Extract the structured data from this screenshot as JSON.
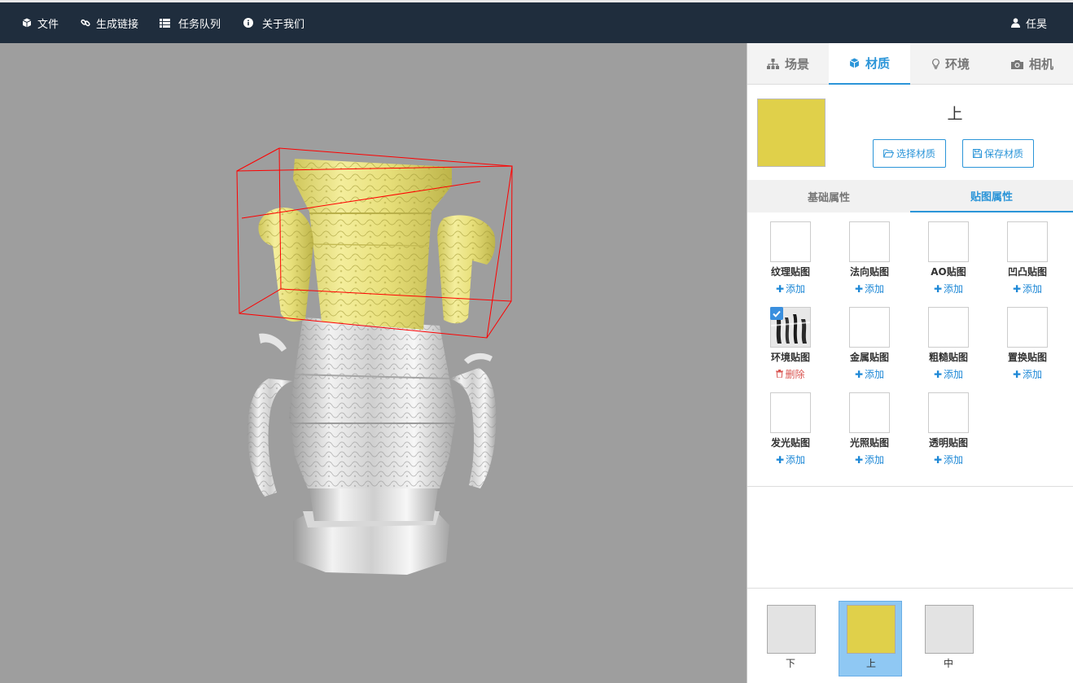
{
  "topbar": {
    "items": [
      {
        "label": "文件",
        "icon": "cube-icon"
      },
      {
        "label": "生成链接",
        "icon": "link-icon"
      },
      {
        "label": "任务队列",
        "icon": "list-icon"
      },
      {
        "label": "关于我们",
        "icon": "info-icon"
      }
    ],
    "user": {
      "label": "任昊",
      "icon": "user-icon"
    }
  },
  "sidebar": {
    "tabs": [
      {
        "label": "场景",
        "icon": "sitemap-icon"
      },
      {
        "label": "材质",
        "icon": "cube-icon"
      },
      {
        "label": "环境",
        "icon": "lightbulb-icon"
      },
      {
        "label": "相机",
        "icon": "camera-icon"
      }
    ],
    "active_tab": "材质",
    "material": {
      "name": "上",
      "color": "#e0d04a",
      "select_label": "选择材质",
      "save_label": "保存材质"
    },
    "subtabs": [
      "基础属性",
      "贴图属性"
    ],
    "active_subtab": "贴图属性",
    "maps": [
      {
        "label": "纹理贴图",
        "action": "添加"
      },
      {
        "label": "法向贴图",
        "action": "添加"
      },
      {
        "label": "AO贴图",
        "action": "添加"
      },
      {
        "label": "凹凸贴图",
        "action": "添加"
      },
      {
        "label": "环境贴图",
        "action": "删除",
        "checked": true
      },
      {
        "label": "金属贴图",
        "action": "添加"
      },
      {
        "label": "粗糙贴图",
        "action": "添加"
      },
      {
        "label": "置换贴图",
        "action": "添加"
      },
      {
        "label": "发光贴图",
        "action": "添加"
      },
      {
        "label": "光照贴图",
        "action": "添加"
      },
      {
        "label": "透明贴图",
        "action": "添加"
      }
    ],
    "material_list": [
      {
        "label": "下",
        "color": "#e3e3e3"
      },
      {
        "label": "上",
        "color": "#e0d04a",
        "selected": true
      },
      {
        "label": "中",
        "color": "#e3e3e3"
      }
    ]
  },
  "colors": {
    "topbar": "#1f2d3d",
    "accent": "#2b95d8",
    "viewport": "#9e9e9e",
    "selection_box": "#ff0000"
  }
}
